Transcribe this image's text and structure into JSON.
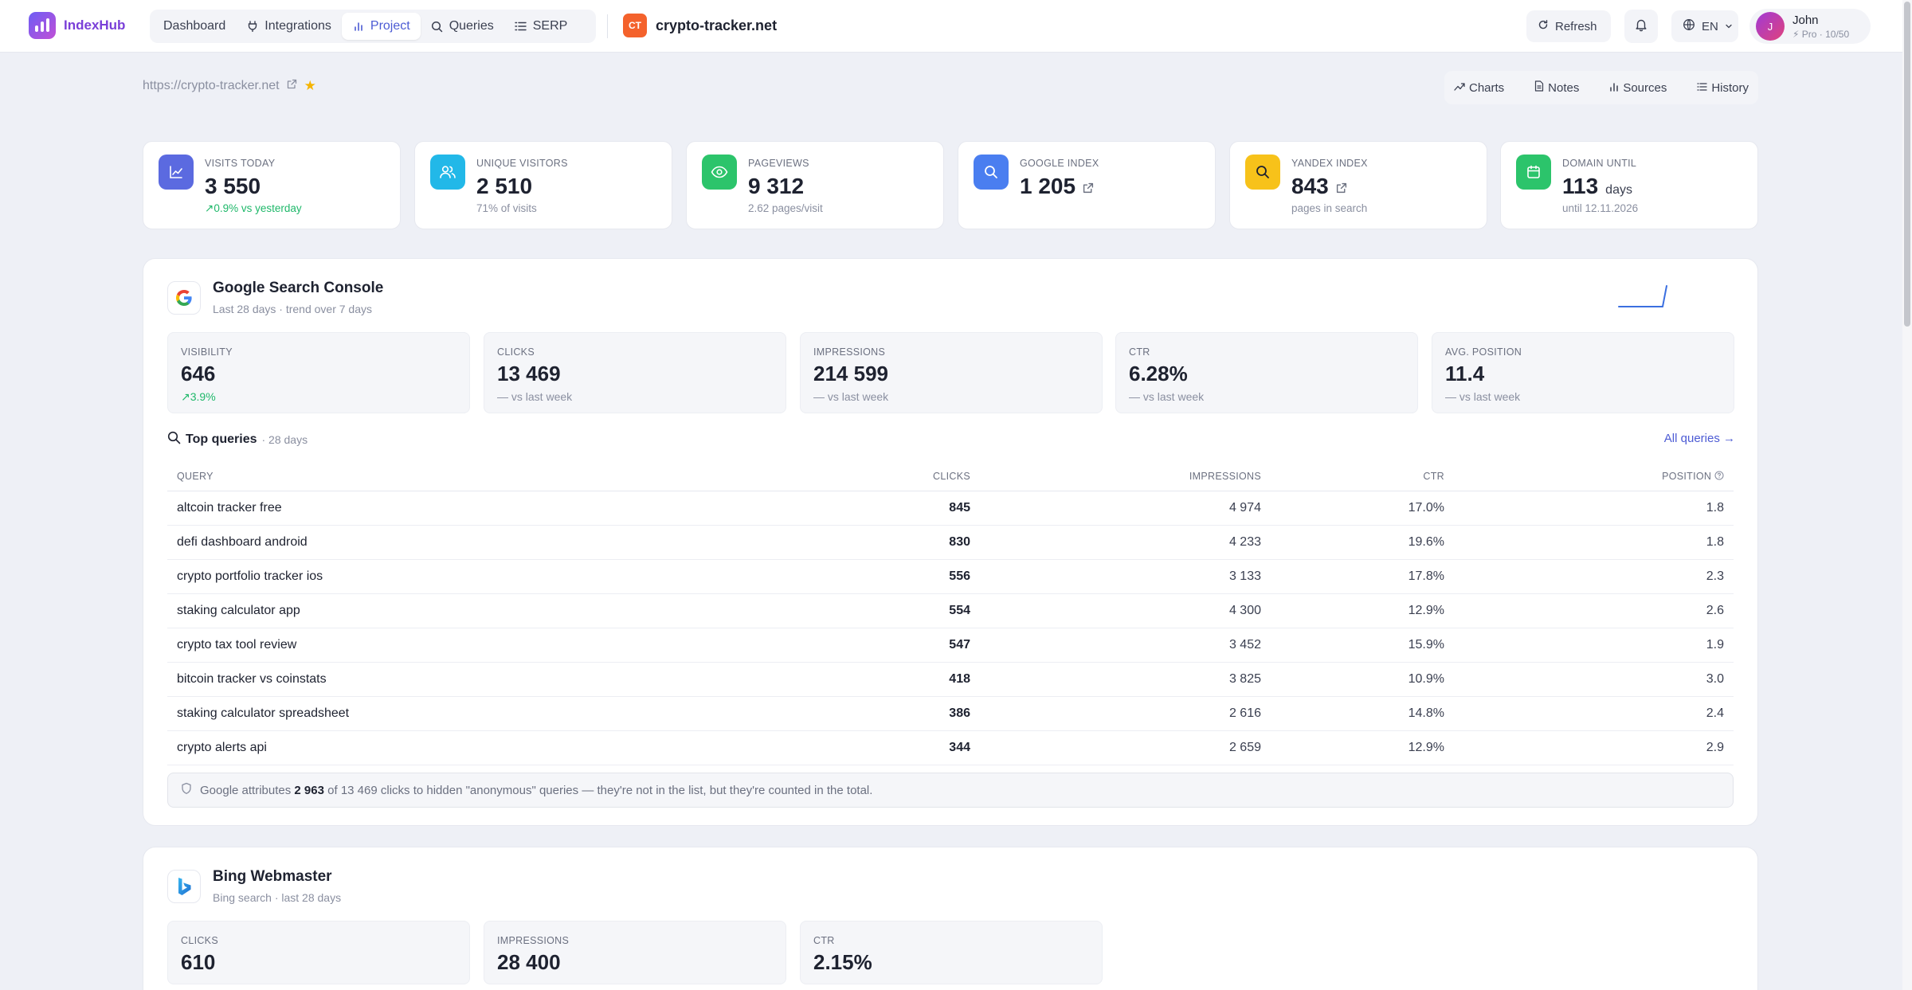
{
  "app": {
    "name": "IndexHub"
  },
  "nav": {
    "items": [
      {
        "label": "Dashboard",
        "icon": ""
      },
      {
        "label": "Integrations",
        "icon": "plug-icon"
      },
      {
        "label": "Project",
        "icon": "bar-chart-icon",
        "active": true
      },
      {
        "label": "Queries",
        "icon": "search-icon"
      },
      {
        "label": "SERP",
        "icon": "list-icon"
      }
    ]
  },
  "project": {
    "badge": "CT",
    "name": "crypto-tracker.net",
    "url": "https://crypto-tracker.net"
  },
  "header": {
    "refresh_label": "Refresh",
    "language": "EN"
  },
  "user": {
    "name": "John",
    "avatar_initial": "J",
    "plan": "Pro · 10/50"
  },
  "tools": [
    "Charts",
    "Notes",
    "Sources",
    "History"
  ],
  "stats": [
    {
      "label": "VISITS TODAY",
      "value": "3 550",
      "sub": "0.9% vs yesterday",
      "color": "#5b6ae0",
      "icon": "line-chart-icon"
    },
    {
      "label": "UNIQUE VISITORS",
      "value": "2 510",
      "sub": "71% of visits",
      "color": "#22b8e8",
      "icon": "users-icon"
    },
    {
      "label": "PAGEVIEWS",
      "value": "9 312",
      "sub": "2.62 pages/visit",
      "color": "#2cc46b",
      "icon": "eye-icon"
    },
    {
      "label": "GOOGLE INDEX",
      "value": "1 205",
      "sub": "",
      "color": "#4a7ef0",
      "icon": "search-icon"
    },
    {
      "label": "YANDEX INDEX",
      "value": "843",
      "sub": "pages in search",
      "color": "#f7c21a",
      "icon": "search-icon"
    },
    {
      "label": "DOMAIN UNTIL",
      "value": "113",
      "unit": "days",
      "sub": "until 12.11.2026",
      "color": "#2cc46b",
      "icon": "calendar-icon"
    }
  ],
  "gsc": {
    "title": "Google Search Console",
    "subtitle": "Last 28 days · trend over 7 days",
    "metrics": [
      {
        "label": "VISIBILITY",
        "value": "646",
        "sub": "3.9%"
      },
      {
        "label": "CLICKS",
        "value": "13 469",
        "sub": "— vs last week"
      },
      {
        "label": "IMPRESSIONS",
        "value": "214 599",
        "sub": "— vs last week"
      },
      {
        "label": "CTR",
        "value": "6.28%",
        "sub": "— vs last week"
      },
      {
        "label": "AVG. POSITION",
        "value": "11.4",
        "sub": "— vs last week"
      }
    ],
    "top_queries_title": "Top queries",
    "top_queries_period": "· 28 days",
    "all_queries_label": "All queries →",
    "columns": [
      "QUERY",
      "CLICKS",
      "IMPRESSIONS",
      "CTR",
      "POSITION"
    ],
    "rows": [
      {
        "query": "altcoin tracker free",
        "clicks": "845",
        "impressions": "4 974",
        "ctr": "17.0%",
        "position": "1.8"
      },
      {
        "query": "defi dashboard android",
        "clicks": "830",
        "impressions": "4 233",
        "ctr": "19.6%",
        "position": "1.8"
      },
      {
        "query": "crypto portfolio tracker ios",
        "clicks": "556",
        "impressions": "3 133",
        "ctr": "17.8%",
        "position": "2.3"
      },
      {
        "query": "staking calculator app",
        "clicks": "554",
        "impressions": "4 300",
        "ctr": "12.9%",
        "position": "2.6"
      },
      {
        "query": "crypto tax tool review",
        "clicks": "547",
        "impressions": "3 452",
        "ctr": "15.9%",
        "position": "1.9"
      },
      {
        "query": "bitcoin tracker vs coinstats",
        "clicks": "418",
        "impressions": "3 825",
        "ctr": "10.9%",
        "position": "3.0"
      },
      {
        "query": "staking calculator spreadsheet",
        "clicks": "386",
        "impressions": "2 616",
        "ctr": "14.8%",
        "position": "2.4"
      },
      {
        "query": "crypto alerts api",
        "clicks": "344",
        "impressions": "2 659",
        "ctr": "12.9%",
        "position": "2.9"
      }
    ],
    "note_prefix": "Google attributes",
    "note_hidden": "2 963",
    "note_suffix": "of 13 469 clicks to hidden \"anonymous\" queries — they're not in the list, but they're counted in the total."
  },
  "bing": {
    "title": "Bing Webmaster",
    "subtitle": "Bing search · last 28 days",
    "metrics": [
      {
        "label": "CLICKS",
        "value": "610"
      },
      {
        "label": "IMPRESSIONS",
        "value": "28 400"
      },
      {
        "label": "CTR",
        "value": "2.15%"
      }
    ]
  }
}
